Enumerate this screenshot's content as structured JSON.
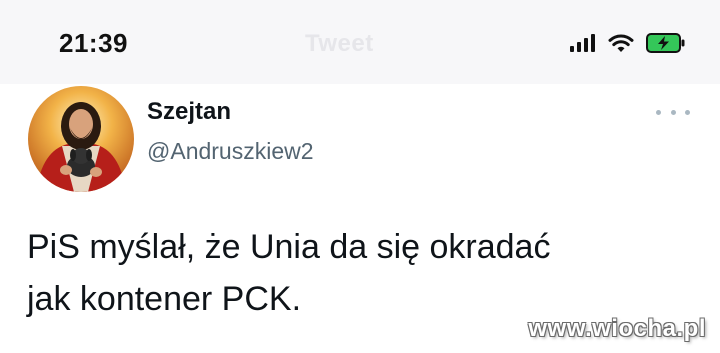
{
  "status_bar": {
    "time": "21:39",
    "faded_title": "Tweet",
    "icons": [
      "signal-icon",
      "wifi-icon",
      "battery-charging-icon"
    ],
    "battery_color": "#34c759"
  },
  "tweet": {
    "author": {
      "display_name": "Szejtan",
      "handle": "@Andruszkiew2",
      "avatar": "avatar-image"
    },
    "more_icon": "more-options-icon",
    "text_lines": [
      "PiS myślał, że Unia da się okradać",
      "jak kontener PCK."
    ]
  },
  "watermark": "www.wiocha.pl"
}
